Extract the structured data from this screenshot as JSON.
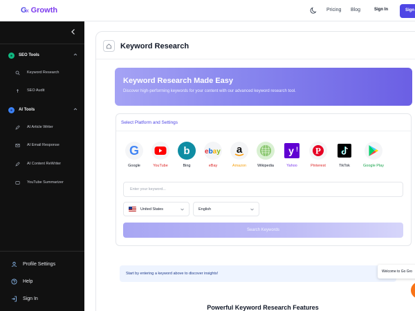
{
  "header": {
    "logo_mark": "G",
    "logo_sub": "X",
    "logo_word": "Growth",
    "nav": [
      "Pricing",
      "Blog"
    ],
    "sign_in": "Sign In",
    "sign_up": "Sign"
  },
  "sidebar": {
    "sections": [
      {
        "label": "SEO Tools",
        "items": [
          "Keyword Research",
          "SEO Audit"
        ]
      },
      {
        "label": "AI Tools",
        "items": [
          "AI Article Writer",
          "AI Email Response",
          "AI Content ReWriter",
          "YouTube Summarizer"
        ]
      }
    ],
    "bottom": [
      "Profile Settings",
      "Help",
      "Sign In"
    ]
  },
  "page": {
    "title": "Keyword Research",
    "hero_title": "Keyword Research Made Easy",
    "hero_subtitle": "Discover high-performing keywords for your content with our advanced keyword research tool.",
    "settings_title": "Select Platform and Settings",
    "platforms": [
      {
        "name": "Google",
        "color": "#111827"
      },
      {
        "name": "YouTube",
        "color": "#dc2626"
      },
      {
        "name": "Bing",
        "color": "#111827"
      },
      {
        "name": "eBay",
        "color": "#dc2626"
      },
      {
        "name": "Amazon",
        "color": "#f59e0b"
      },
      {
        "name": "Wikipedia",
        "color": "#111827"
      },
      {
        "name": "Yahoo",
        "color": "#7c3aed"
      },
      {
        "name": "Pinterest",
        "color": "#dc2626"
      },
      {
        "name": "TikTok",
        "color": "#111827"
      },
      {
        "name": "Google Play",
        "color": "#16a34a"
      }
    ],
    "keyword_placeholder": "Enter your keyword...",
    "country": "United States",
    "language": "English",
    "search_button": "Search Keywords",
    "info_text": "Start by entering a keyword above to discover insights!",
    "toast_text": "Welcome to Go Gro",
    "features_heading": "Powerful Keyword Research Features"
  },
  "colors": {
    "accent": "#4f46e5",
    "sidebar_bg": "#111111",
    "fab": "#f97316"
  }
}
